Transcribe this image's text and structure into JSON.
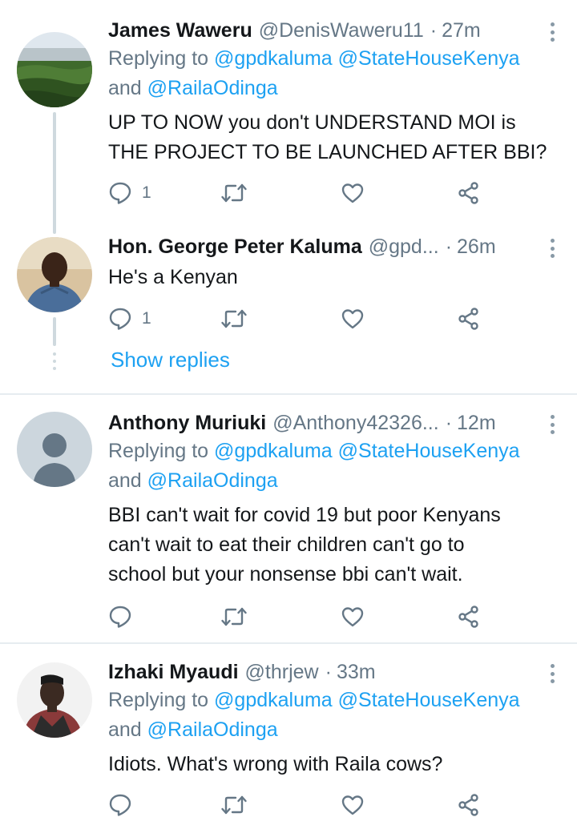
{
  "tweets": [
    {
      "name": "James Waweru",
      "handle": "@DenisWaweru11",
      "time": "27m",
      "replying_prefix": "Replying to",
      "reply_mentions_1": "@gpdkaluma @StateHouseKenya",
      "reply_and": "and",
      "reply_mentions_2": "@RailaOdinga",
      "body_line1": "UP TO NOW you don't UNDERSTAND MOI is",
      "body_line2": "THE PROJECT TO BE LAUNCHED AFTER BBI?",
      "reply_count": "1"
    },
    {
      "name": "Hon. George Peter Kaluma",
      "handle": "@gpd...",
      "time": "26m",
      "body_line1": "He's a Kenyan",
      "reply_count": "1"
    },
    {
      "name": "Anthony Muriuki",
      "handle": "@Anthony42326...",
      "time": "12m",
      "replying_prefix": "Replying to",
      "reply_mentions_1": "@gpdkaluma @StateHouseKenya",
      "reply_and": "and",
      "reply_mentions_2": "@RailaOdinga",
      "body_line1": "BBI can't wait for covid 19 but poor Kenyans",
      "body_line2": "can't wait to eat their children can't go to",
      "body_line3": "school but your nonsense bbi can't wait."
    },
    {
      "name": "Izhaki Myaudi",
      "handle": "@thrjew",
      "time": "33m",
      "replying_prefix": "Replying to",
      "reply_mentions_1": "@gpdkaluma @StateHouseKenya",
      "reply_and": "and",
      "reply_mentions_2": "@RailaOdinga",
      "body_line1": "Idiots. What's wrong with Raila cows?"
    }
  ],
  "show_replies": "Show replies",
  "separator_dot": "·",
  "colors": {
    "accent": "#1da1f2",
    "secondary_text": "#657786",
    "icon": "#657786",
    "divider": "#e6ecf0"
  },
  "icons": [
    "reply-icon",
    "retweet-icon",
    "like-icon",
    "share-icon",
    "more-options-icon"
  ]
}
